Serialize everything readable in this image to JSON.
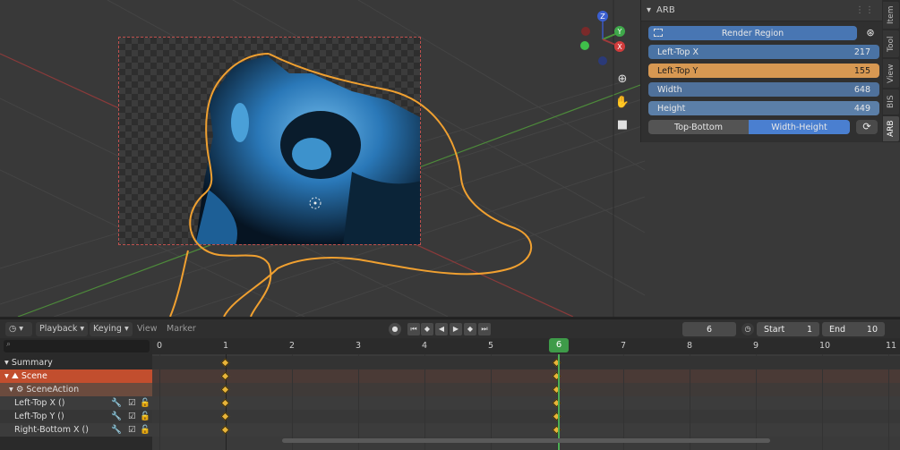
{
  "npanel": {
    "title": "ARB",
    "render_region_label": "Render Region",
    "fields": [
      {
        "label": "Left-Top X",
        "value": "217"
      },
      {
        "label": "Left-Top Y",
        "value": "155"
      },
      {
        "label": "Width",
        "value": "648"
      },
      {
        "label": "Height",
        "value": "449"
      }
    ],
    "mode_options": [
      "Top-Bottom",
      "Width-Height"
    ],
    "selected_mode": "Width-Height",
    "tabs": [
      "Item",
      "Tool",
      "View",
      "BIS",
      "ARB"
    ],
    "active_tab": "ARB"
  },
  "gizmo": {
    "x": "X",
    "y": "Y",
    "z": "Z"
  },
  "timeline": {
    "menus": {
      "playback": "Playback",
      "keying": "Keying",
      "view": "View",
      "marker": "Marker"
    },
    "current_frame": "6",
    "start_label": "Start",
    "start_value": "1",
    "end_label": "End",
    "end_value": "10",
    "ruler_ticks": [
      "0",
      "1",
      "2",
      "3",
      "4",
      "5",
      "6",
      "7",
      "8",
      "9",
      "10",
      "11"
    ],
    "playhead_label": "6",
    "channels": {
      "summary": "Summary",
      "scene": "Scene",
      "action": "SceneAction",
      "fcurves": [
        "Left-Top X ()",
        "Left-Top Y ()",
        "Right-Bottom X ()"
      ]
    },
    "keyframe_frames": [
      1,
      6
    ]
  }
}
